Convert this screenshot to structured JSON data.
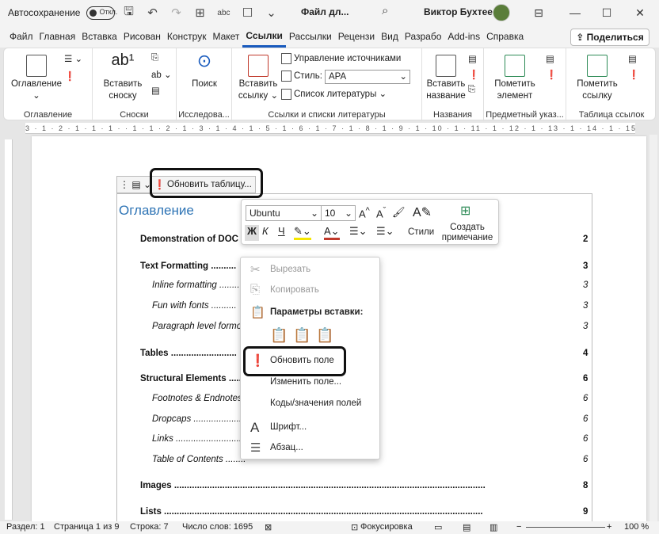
{
  "titlebar": {
    "autosave_label": "Автосохранение",
    "autosave_state": "Откл.",
    "doc_title": "Файл дл...",
    "user_name": "Виктор Бухтеев"
  },
  "tabs": [
    "Файл",
    "Главная",
    "Вставка",
    "Рисован",
    "Конструк",
    "Макет",
    "Ссылки",
    "Рассылки",
    "Рецензи",
    "Вид",
    "Разрабо",
    "Add-ins",
    "Справка"
  ],
  "active_tab": "Ссылки",
  "share_label": "Поделиться",
  "ribbon": {
    "toc_group": {
      "button": "Оглавление",
      "label": "Оглавление"
    },
    "footnotes_group": {
      "button_line1": "Вставить",
      "button_line2": "сноску",
      "label": "Сноски"
    },
    "research_group": {
      "button": "Поиск",
      "label": "Исследова..."
    },
    "citations_group": {
      "button_line1": "Вставить",
      "button_line2": "ссылку",
      "manage_sources": "Управление источниками",
      "style_label": "Стиль:",
      "style_value": "APA",
      "bibliography": "Список литературы",
      "label": "Ссылки и списки литературы"
    },
    "captions_group": {
      "button_line1": "Вставить",
      "button_line2": "название",
      "label": "Названия"
    },
    "index_group": {
      "button_line1": "Пометить",
      "button_line2": "элемент",
      "label": "Предметный указ..."
    },
    "authorities_group": {
      "button_line1": "Пометить",
      "button_line2": "ссылку",
      "label": "Таблица ссылок"
    }
  },
  "ruler_text": "3 · 1 · 2 · 1 · 1 · 1 · · 1 · 1 · 2 · 1 · 3 · 1 · 4 · 1 · 5 · 1 · 6 · 1 · 7 · 1 · 8 · 1 · 9 · 1 · 10 · 1 · 11 · 1 · 12 · 1 · 13 · 1 · 14 · 1 · 15 · 1 · 16 · 1 · 17 · 1 ·",
  "field_toolbar": {
    "update_table": "Обновить таблицу..."
  },
  "toc": {
    "heading": "Оглавление",
    "entries": [
      {
        "text": "Demonstration of DOC",
        "page": "2",
        "level": 1
      },
      {
        "text": "Text Formatting ..........",
        "page": "3",
        "level": 1
      },
      {
        "text": "Inline formatting ..........",
        "page": "3",
        "level": 2
      },
      {
        "text": "Fun with fonts ..........",
        "page": "3",
        "level": 2
      },
      {
        "text": "Paragraph level formo",
        "page": "3",
        "level": 2
      },
      {
        "text": "Tables ..........................",
        "page": "4",
        "level": 1
      },
      {
        "text": "Structural Elements ......",
        "page": "6",
        "level": 1
      },
      {
        "text": "Footnotes & Endnotes",
        "page": "6",
        "level": 2
      },
      {
        "text": "Dropcaps ....................",
        "page": "6",
        "level": 2
      },
      {
        "text": "Links ..........................",
        "page": "6",
        "level": 2
      },
      {
        "text": "Table of Contents ........",
        "page": "6",
        "level": 2
      },
      {
        "text": "Images ...........................................................................................................................",
        "page": "8",
        "level": 1
      },
      {
        "text": "Lists ..............................................................................................................................",
        "page": "9",
        "level": 1
      }
    ]
  },
  "minibar": {
    "font": "Ubuntu",
    "size": "10",
    "bold": "Ж",
    "italic": "К",
    "underline": "Ч",
    "styles": "Стили",
    "comment_line1": "Создать",
    "comment_line2": "примечание"
  },
  "context_menu": {
    "cut": "Вырезать",
    "copy": "Копировать",
    "paste_options": "Параметры вставки:",
    "update_field": "Обновить поле",
    "edit_field": "Изменить поле...",
    "toggle_codes": "Коды/значения полей",
    "font": "Шрифт...",
    "paragraph": "Абзац..."
  },
  "statusbar": {
    "section": "Раздел: 1",
    "page": "Страница 1 из 9",
    "line": "Строка: 7",
    "words": "Число слов: 1695",
    "focus": "Фокусировка",
    "zoom": "100 %"
  },
  "colors": {
    "accent": "#185abd",
    "heading": "#2e74b5"
  }
}
